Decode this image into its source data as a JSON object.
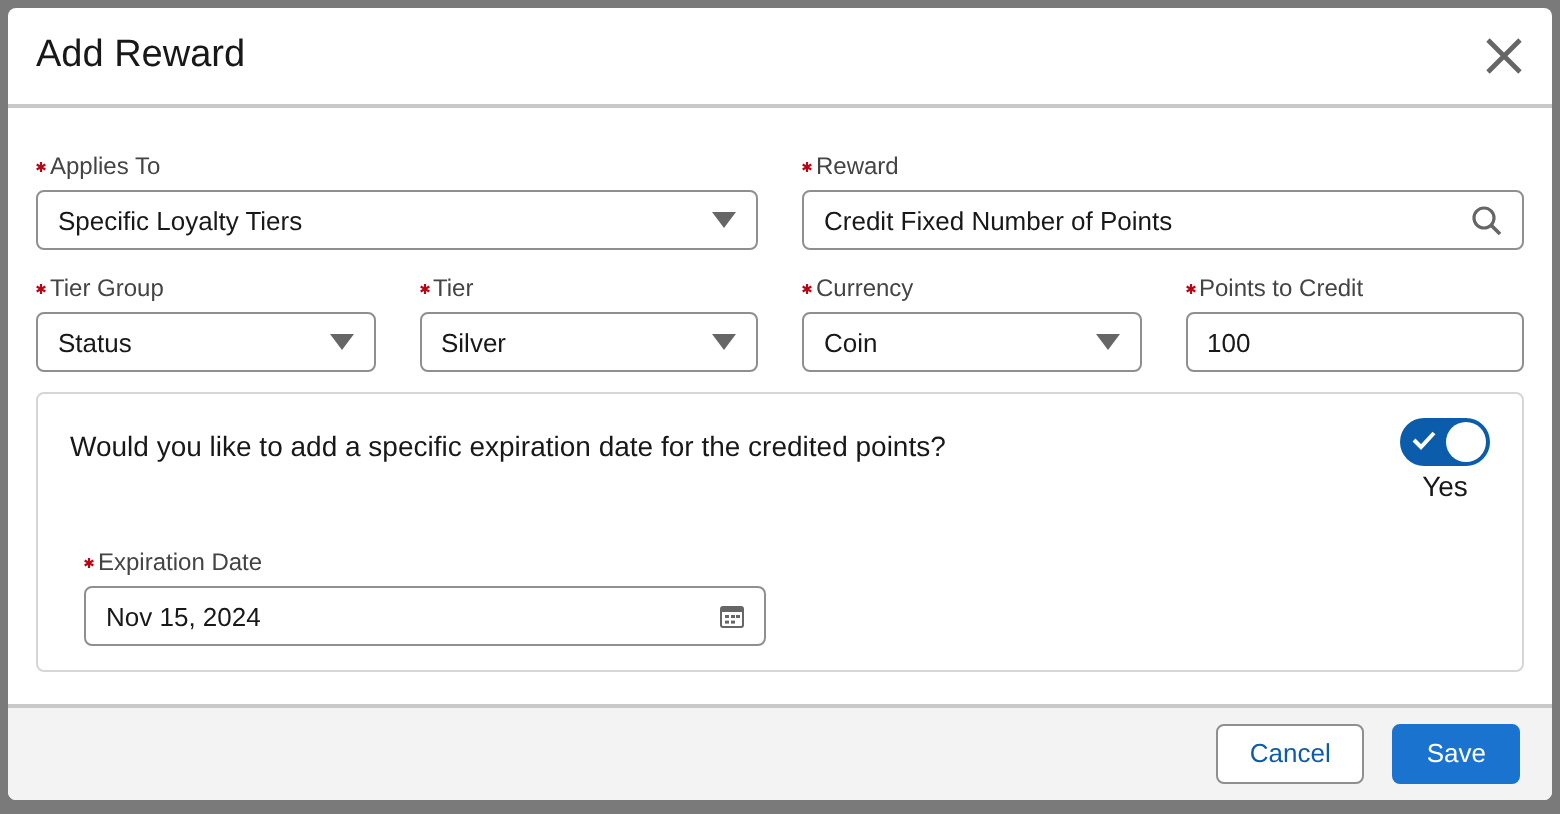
{
  "modal": {
    "title": "Add Reward"
  },
  "field_rows": [
    [
      {
        "label": "Applies To",
        "required": true,
        "kind": "select",
        "value": "Specific Loyalty Tiers"
      },
      {
        "label": "Reward",
        "required": true,
        "kind": "search",
        "value": "Credit Fixed Number of Points"
      }
    ],
    [
      {
        "label": "Tier Group",
        "required": true,
        "kind": "select",
        "value": "Status"
      },
      {
        "label": "Tier",
        "required": true,
        "kind": "select",
        "value": "Silver"
      },
      {
        "label": "Currency",
        "required": true,
        "kind": "select",
        "value": "Coin"
      },
      {
        "label": "Points to Credit",
        "required": true,
        "kind": "text",
        "value": "100"
      }
    ]
  ],
  "expiration": {
    "question": "Would you like to add a specific expiration date for the credited points?",
    "toggle": {
      "on": true,
      "label": "Yes"
    },
    "field": {
      "label": "Expiration Date",
      "required": true,
      "kind": "date",
      "value": "Nov 15, 2024"
    }
  },
  "buttons": [
    {
      "label": "Cancel",
      "kind": "neutral"
    },
    {
      "label": "Save",
      "kind": "brand"
    }
  ]
}
